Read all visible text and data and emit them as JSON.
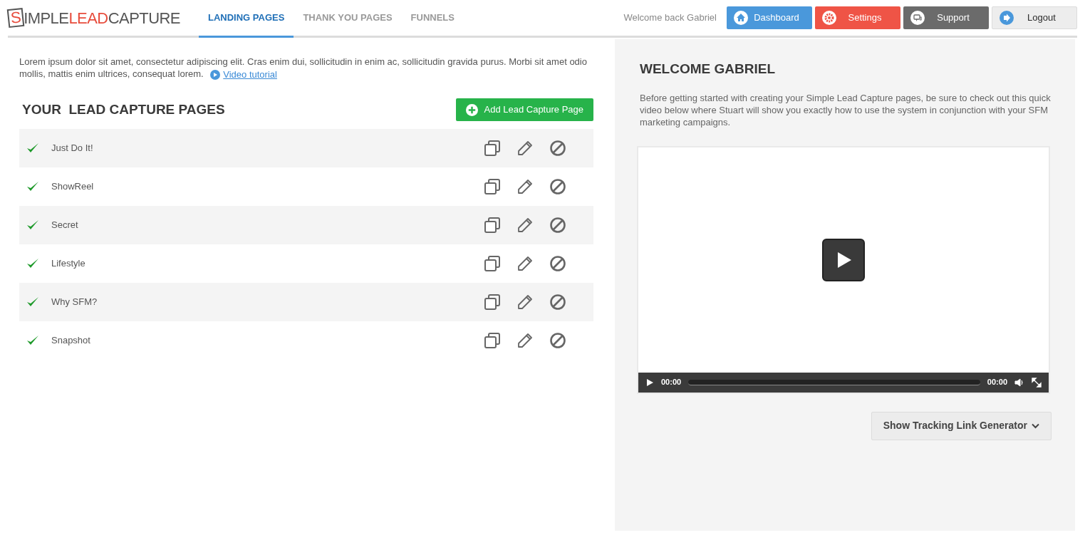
{
  "logo": {
    "initial": "S",
    "part_1": "IMPLE",
    "part_2": "LEAD",
    "part_3": "CAPTURE"
  },
  "tabs": [
    {
      "label": "LANDING PAGES",
      "selected": true
    },
    {
      "label": "THANK YOU PAGES",
      "selected": false
    },
    {
      "label": "FUNNELS",
      "selected": false
    }
  ],
  "welcome": "Welcome back Gabriel",
  "nav_buttons": [
    {
      "label": "Dashboard",
      "kind": "dashboard"
    },
    {
      "label": "Settings",
      "kind": "settings"
    },
    {
      "label": "Support",
      "kind": "support"
    },
    {
      "label": "Logout",
      "kind": "logout"
    }
  ],
  "intro": "Lorem ipsum dolor sit amet, consectetur adipiscing elit. Cras enim dui, sollicitudin in enim ac, sollicitudin gravida purus. Morbi sit amet odio mollis, mattis enim ultrices, consequat lorem.",
  "video_link": "Video tutorial",
  "pages_title": "YOUR  LEAD CAPTURE PAGES",
  "add_button": "Add Lead Capture Page",
  "pages": [
    {
      "name": "Just Do It!",
      "active": true
    },
    {
      "name": "ShowReel",
      "active": true
    },
    {
      "name": "Secret",
      "active": true
    },
    {
      "name": "Lifestyle",
      "active": true
    },
    {
      "name": "Why SFM?",
      "active": true
    },
    {
      "name": "Snapshot",
      "active": true
    }
  ],
  "panel": {
    "title": "WELCOME GABRIEL",
    "text": "Before getting started with creating your Simple Lead Capture pages, be sure to check out this quick video below where Stuart will show you exactly how to use the system in conjunction with your SFM marketing campaigns.",
    "video": {
      "current_time": "00:00",
      "duration": "00:00"
    },
    "tracking_button": "Show Tracking Link Generator"
  }
}
